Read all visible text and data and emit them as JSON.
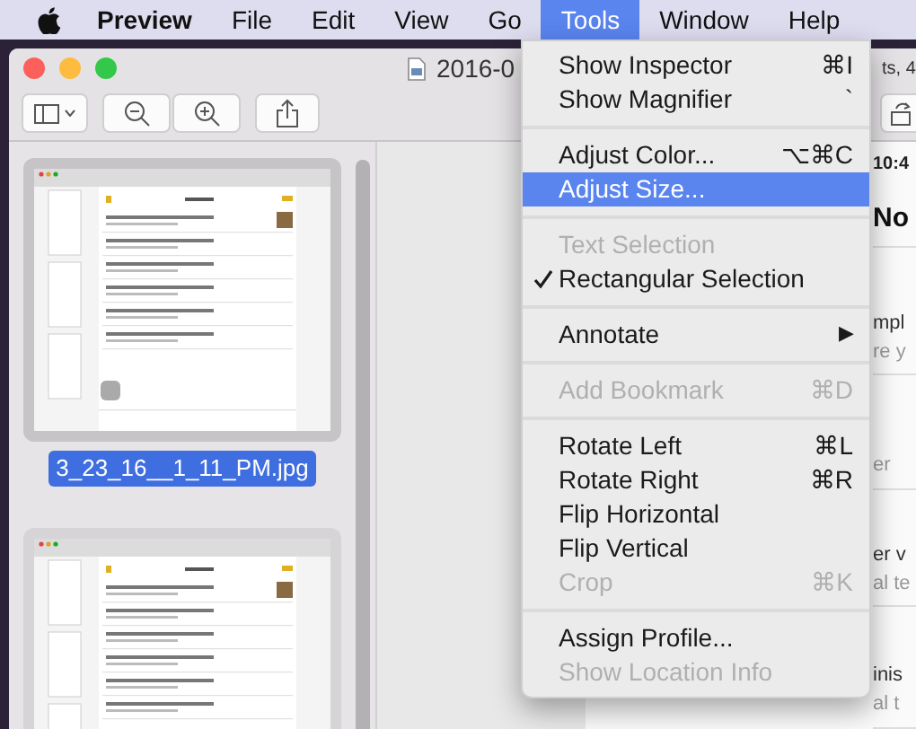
{
  "menu_bar": {
    "items": [
      {
        "label": "Preview",
        "kind": "app",
        "selected": false
      },
      {
        "label": "File",
        "kind": "menu",
        "selected": false
      },
      {
        "label": "Edit",
        "kind": "menu",
        "selected": false
      },
      {
        "label": "View",
        "kind": "menu",
        "selected": false
      },
      {
        "label": "Go",
        "kind": "menu",
        "selected": false
      },
      {
        "label": "Tools",
        "kind": "menu",
        "selected": true
      },
      {
        "label": "Window",
        "kind": "menu",
        "selected": false
      },
      {
        "label": "Help",
        "kind": "menu",
        "selected": false
      }
    ]
  },
  "window": {
    "title": "2016-0",
    "title_end": "ts, 4"
  },
  "sidebar": {
    "thumbnails": [
      {
        "caption": "3_23_16__1_11_PM.jpg",
        "selected": true
      },
      {
        "selected": false
      }
    ]
  },
  "document": {
    "fragments": [
      {
        "text": "10:4",
        "kind": "status"
      },
      {
        "text": "No",
        "kind": "heading"
      },
      {
        "text": "mpl",
        "kind": "line"
      },
      {
        "text": "re y",
        "kind": "sub"
      },
      {
        "text": "er",
        "kind": "sub"
      },
      {
        "text": "er v",
        "kind": "line"
      },
      {
        "text": "al te",
        "kind": "sub"
      },
      {
        "text": "inis",
        "kind": "line"
      },
      {
        "text": "al t",
        "kind": "sub"
      }
    ]
  },
  "tools_menu": {
    "items": [
      {
        "kind": "item",
        "label": "Show Inspector",
        "shortcut": "⌘I",
        "disabled": false,
        "checked": false,
        "selected": false
      },
      {
        "kind": "item",
        "label": "Show Magnifier",
        "shortcut": "`",
        "disabled": false,
        "checked": false,
        "selected": false
      },
      {
        "kind": "separator"
      },
      {
        "kind": "item",
        "label": "Adjust Color...",
        "shortcut": "⌥⌘C",
        "disabled": false,
        "checked": false,
        "selected": false
      },
      {
        "kind": "item",
        "label": "Adjust Size...",
        "disabled": false,
        "checked": false,
        "selected": true
      },
      {
        "kind": "separator"
      },
      {
        "kind": "item",
        "label": "Text Selection",
        "disabled": true,
        "checked": false,
        "selected": false
      },
      {
        "kind": "item",
        "label": "Rectangular Selection",
        "disabled": false,
        "checked": true,
        "selected": false
      },
      {
        "kind": "separator"
      },
      {
        "kind": "item",
        "label": "Annotate",
        "submenu": "▶",
        "disabled": false,
        "checked": false,
        "selected": false
      },
      {
        "kind": "separator"
      },
      {
        "kind": "item",
        "label": "Add Bookmark",
        "shortcut": "⌘D",
        "disabled": true,
        "checked": false,
        "selected": false
      },
      {
        "kind": "separator"
      },
      {
        "kind": "item",
        "label": "Rotate Left",
        "shortcut": "⌘L",
        "disabled": false,
        "checked": false,
        "selected": false
      },
      {
        "kind": "item",
        "label": "Rotate Right",
        "shortcut": "⌘R",
        "disabled": false,
        "checked": false,
        "selected": false
      },
      {
        "kind": "item",
        "label": "Flip Horizontal",
        "disabled": false,
        "checked": false,
        "selected": false
      },
      {
        "kind": "item",
        "label": "Flip Vertical",
        "disabled": false,
        "checked": false,
        "selected": false
      },
      {
        "kind": "item",
        "label": "Crop",
        "shortcut": "⌘K",
        "disabled": true,
        "checked": false,
        "selected": false
      },
      {
        "kind": "separator"
      },
      {
        "kind": "item",
        "label": "Assign Profile...",
        "disabled": false,
        "checked": false,
        "selected": false
      },
      {
        "kind": "item",
        "label": "Show Location Info",
        "disabled": true,
        "checked": false,
        "selected": false
      }
    ]
  }
}
